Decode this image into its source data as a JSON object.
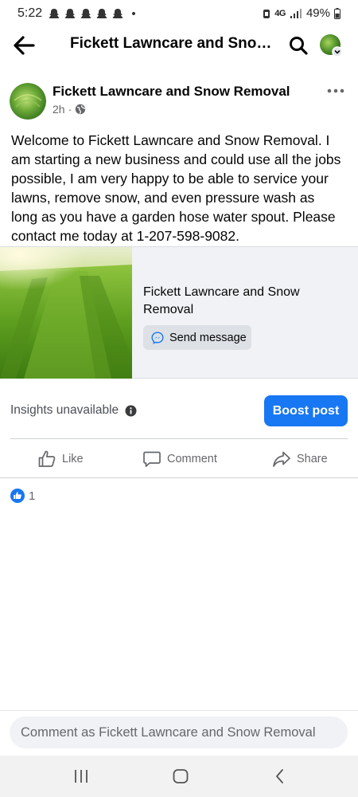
{
  "status_bar": {
    "time": "5:22",
    "network": "4G",
    "battery": "49%",
    "notification_icons": [
      "snapchat-icon",
      "snapchat-icon",
      "snapchat-icon",
      "snapchat-icon",
      "snapchat-icon"
    ]
  },
  "nav": {
    "title": "Fickett Lawncare and Snow R...",
    "back_icon": "arrow-left-icon",
    "search_icon": "search-icon"
  },
  "post": {
    "author": "Fickett Lawncare and Snow Removal",
    "time": "2h",
    "separator": "·",
    "privacy_icon": "globe-icon",
    "text": "Welcome to Fickett Lawncare and Snow Removal. I am starting a new business and could use all the jobs possible, I am very happy to be able to service your lawns, remove snow, and even pressure wash as long as you have a garden hose water spout. Please contact me today at 1-207-598-9082."
  },
  "link_card": {
    "title": "Fickett Lawncare and Snow Removal",
    "button_label": "Send message",
    "button_icon": "messenger-icon"
  },
  "insights": {
    "label": "Insights unavailable",
    "info_icon": "info-icon",
    "boost_label": "Boost post"
  },
  "actions": {
    "like": "Like",
    "comment": "Comment",
    "share": "Share"
  },
  "reactions": {
    "count": "1",
    "icon": "like-reaction-icon"
  },
  "comment_bar": {
    "placeholder": "Comment as Fickett Lawncare and Snow Removal"
  },
  "colors": {
    "accent": "#1877f2",
    "secondary_text": "#65676b",
    "card_bg": "#f0f2f5"
  }
}
